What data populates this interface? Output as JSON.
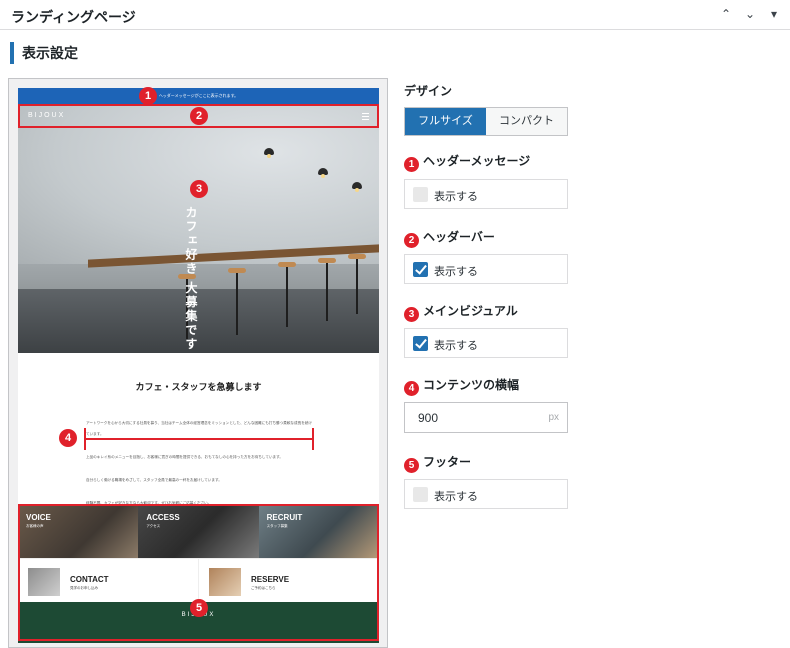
{
  "panel": {
    "title": "ランディングページ"
  },
  "section": {
    "title": "表示設定"
  },
  "preview": {
    "header_message": "ヘッダーメッセージがここに表示されます。",
    "brand": "BIJOUX",
    "hero_copy": "カフェ好き 大募集です",
    "content_title": "カフェ・スタッフを急募します",
    "content_paragraphs": [
      "アートワークを心から大切にする社員を募り、当社はチーム全体の経営理念をミッションとした、どんな困難にも打ち勝つ柔軟な成長を続けています。",
      "上品のキレイ系のメニューを目指し、お客様に寛ぎの時間を提供できる、おもてなしの心を持った方をお待ちしています。",
      "自分らしく働ける職場をめざして、スタッフ全員で最高の一杯をお届けしています。",
      "経験不問、カフェが好きな方なら大歓迎です。ぜひお気軽にご応募ください。"
    ],
    "cards": [
      {
        "title": "VOICE",
        "sub": "お客様の声"
      },
      {
        "title": "ACCESS",
        "sub": "アクセス"
      },
      {
        "title": "RECRUIT",
        "sub": "スタッフ募集"
      }
    ],
    "links": [
      {
        "title": "CONTACT",
        "sub": "見学のお申し込み"
      },
      {
        "title": "RESERVE",
        "sub": "ご予約はこちら"
      }
    ],
    "footer_brand": "BIJOUX",
    "markers": [
      "1",
      "2",
      "3",
      "4",
      "5"
    ]
  },
  "settings": {
    "design_label": "デザイン",
    "design_options": [
      "フルサイズ",
      "コンパクト"
    ],
    "design_selected": "フルサイズ",
    "header_message": {
      "num": "1",
      "label": "ヘッダーメッセージ",
      "check_label": "表示する",
      "checked": false
    },
    "header_bar": {
      "num": "2",
      "label": "ヘッダーバー",
      "check_label": "表示する",
      "checked": true
    },
    "main_visual": {
      "num": "3",
      "label": "メインビジュアル",
      "check_label": "表示する",
      "checked": true
    },
    "content_width": {
      "num": "4",
      "label": "コンテンツの横幅",
      "value": "900",
      "unit": "px"
    },
    "footer": {
      "num": "5",
      "label": "フッター",
      "check_label": "表示する",
      "checked": false
    }
  },
  "colors": {
    "accent": "#2271b1",
    "marker": "#e0212b",
    "footer_bg": "#1d4a34",
    "message_bar": "#1d64b7"
  },
  "icons": [
    "chevron-up-icon",
    "chevron-down-icon",
    "triangle-down-icon"
  ]
}
